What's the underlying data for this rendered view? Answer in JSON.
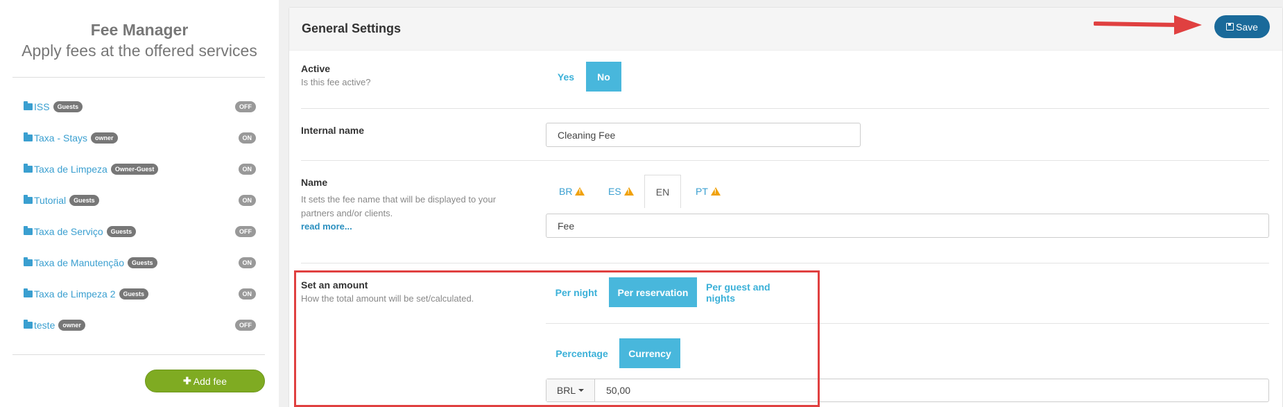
{
  "sidebar": {
    "title": "Fee Manager",
    "subtitle": "Apply fees at the offered services",
    "items": [
      {
        "name": "ISS",
        "badge": "Guests",
        "status": "OFF"
      },
      {
        "name": "Taxa - Stays",
        "badge": "owner",
        "status": "ON"
      },
      {
        "name": "Taxa de Limpeza",
        "badge": "Owner-Guest",
        "status": "ON"
      },
      {
        "name": "Tutorial",
        "badge": "Guests",
        "status": "ON"
      },
      {
        "name": "Taxa de Serviço",
        "badge": "Guests",
        "status": "OFF"
      },
      {
        "name": "Taxa de Manutenção",
        "badge": "Guests",
        "status": "ON"
      },
      {
        "name": "Taxa de Limpeza 2",
        "badge": "Guests",
        "status": "ON"
      },
      {
        "name": "teste",
        "badge": "owner",
        "status": "OFF"
      }
    ],
    "add_label": "Add fee"
  },
  "panel": {
    "title": "General Settings",
    "save_label": "Save"
  },
  "active": {
    "label": "Active",
    "desc": "Is this fee active?",
    "yes": "Yes",
    "no": "No",
    "selected": "No"
  },
  "internal_name": {
    "label": "Internal name",
    "value": "Cleaning Fee"
  },
  "name": {
    "label": "Name",
    "desc": "It sets the fee name that will be displayed to your partners and/or clients.",
    "read_more": "read more...",
    "tabs": [
      "BR",
      "ES",
      "EN",
      "PT"
    ],
    "active_tab": "EN",
    "value": "Fee"
  },
  "amount": {
    "label": "Set an amount",
    "desc": "How the total amount will be set/calculated.",
    "modes": [
      "Per night",
      "Per reservation",
      "Per guest and nights"
    ],
    "selected_mode": "Per reservation",
    "types": [
      "Percentage",
      "Currency"
    ],
    "selected_type": "Currency",
    "currency": "BRL",
    "value": "50,00"
  },
  "colors": {
    "accent": "#48b7dc",
    "save": "#1a6a9a",
    "add": "#7fab22",
    "highlight": "#e04040",
    "warning": "#f0a10a"
  }
}
